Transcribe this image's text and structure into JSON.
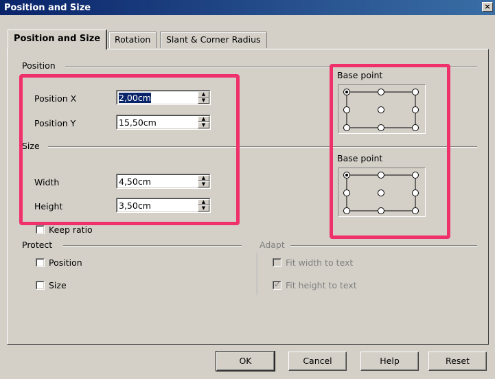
{
  "window": {
    "title": "Position and Size",
    "close_glyph": "×"
  },
  "tabs": [
    {
      "label": "Position and Size",
      "active": true
    },
    {
      "label": "Rotation",
      "active": false
    },
    {
      "label": "Slant & Corner Radius",
      "active": false
    }
  ],
  "position": {
    "section_label": "Position",
    "x_label": "Position X",
    "x_value": "2,00cm",
    "y_label": "Position Y",
    "y_value": "15,50cm",
    "base_point_label": "Base point"
  },
  "size": {
    "section_label": "Size",
    "width_label": "Width",
    "width_value": "4,50cm",
    "height_label": "Height",
    "height_value": "3,50cm",
    "keep_ratio_label": "Keep ratio",
    "base_point_label": "Base point"
  },
  "protect": {
    "section_label": "Protect",
    "position_label": "Position",
    "size_label": "Size"
  },
  "adapt": {
    "section_label": "Adapt",
    "fit_width_label": "Fit width to text",
    "fit_height_label": "Fit height to text"
  },
  "buttons": {
    "ok": "OK",
    "cancel": "Cancel",
    "help": "Help",
    "reset": "Reset"
  },
  "colors": {
    "highlight": "#f0306b",
    "title_bar": "#0a246a",
    "dialog_bg": "#d4d0c8"
  },
  "icons": {
    "spin_up": "▲",
    "spin_down": "▼",
    "check": "✓"
  }
}
